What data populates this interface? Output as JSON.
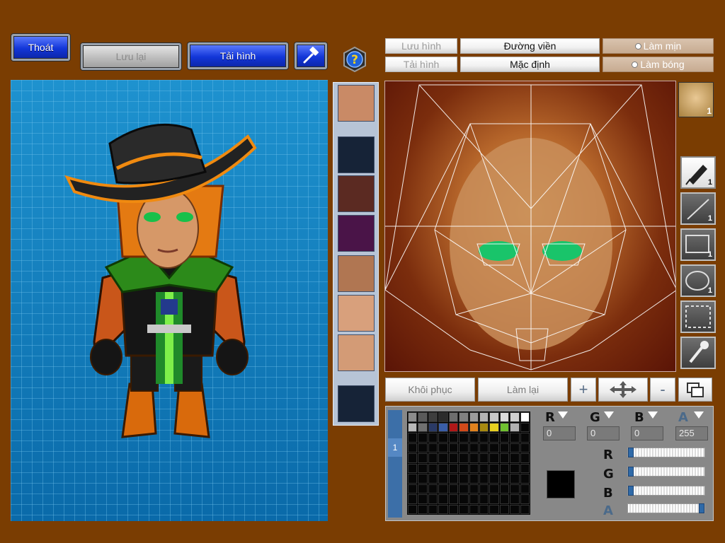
{
  "toolbar": {
    "exit_label": "Thoát",
    "save_label": "Lưu lại",
    "load_label": "Tải hình",
    "hammer_icon": "hammer-icon",
    "help_icon": "question-icon"
  },
  "editor_controls": {
    "save_image": "Lưu hình",
    "load_image": "Tải hình",
    "outline": "Đường viền",
    "default": "Mặc định",
    "smooth": "Làm mịn",
    "shade": "Làm bóng"
  },
  "thumbnails": [
    "face-portrait",
    "empty-slot",
    "head-top",
    "torso-texture",
    "face-eyes",
    "face-nose",
    "face-chin",
    "empty-slot"
  ],
  "tools": [
    {
      "icon": "pen-icon",
      "count": "1",
      "active": true
    },
    {
      "icon": "line-icon",
      "count": "1",
      "active": false
    },
    {
      "icon": "rectangle-icon",
      "count": "1",
      "active": false
    },
    {
      "icon": "ellipse-icon",
      "count": "1",
      "active": false
    },
    {
      "icon": "selection-icon",
      "count": "",
      "active": false
    },
    {
      "icon": "eyedropper-icon",
      "count": "",
      "active": false
    }
  ],
  "actions": {
    "restore": "Khôi phục",
    "redo": "Làm lại",
    "zoom_in": "+",
    "zoom_out": "-"
  },
  "color": {
    "channels": [
      "R",
      "G",
      "B",
      "A"
    ],
    "r": "0",
    "g": "0",
    "b": "0",
    "a": "255",
    "current": "#000000",
    "alpha_fraction": 1.0,
    "r_fraction": 0.0,
    "g_fraction": 0.0,
    "b_fraction": 0.0
  },
  "palette_colors": [
    "#8c8c8c",
    "#5a5a5a",
    "#3e3e3e",
    "#2c2c2c",
    "#6e6e6e",
    "#808080",
    "#9c9c9c",
    "#b4b4b4",
    "#c8c8c8",
    "#dadada",
    "#d0d0d0",
    "#ffffff",
    "#b8b8b8",
    "#707070",
    "#2a3a66",
    "#3a5ea8",
    "#b01818",
    "#d24a1a",
    "#e0821e",
    "#a88a10",
    "#e8d020",
    "#70c030",
    "#b0b0b0"
  ],
  "palette_tab_label": "1"
}
